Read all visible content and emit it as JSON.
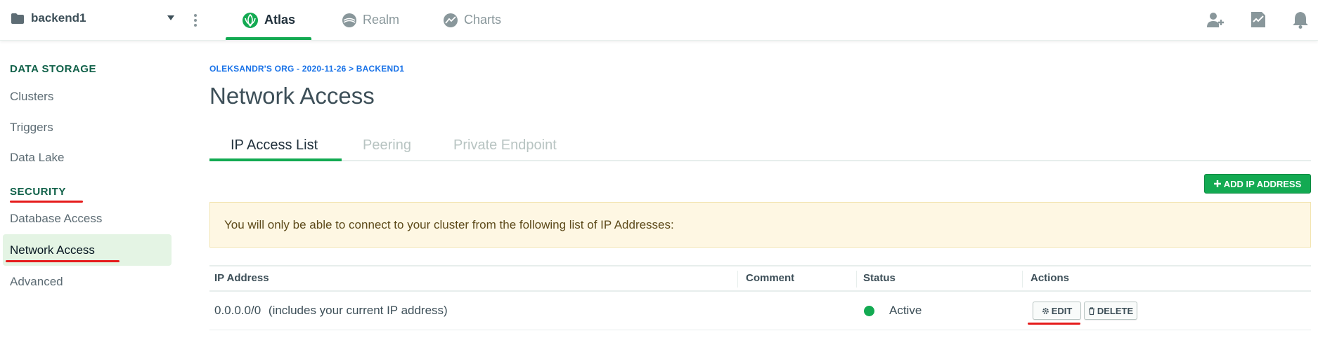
{
  "project": {
    "name": "backend1"
  },
  "nav": {
    "tabs": [
      {
        "label": "Atlas"
      },
      {
        "label": "Realm"
      },
      {
        "label": "Charts"
      }
    ]
  },
  "sidebar": {
    "sections": [
      {
        "heading": "DATA STORAGE",
        "items": [
          {
            "label": "Clusters"
          },
          {
            "label": "Triggers"
          },
          {
            "label": "Data Lake"
          }
        ]
      },
      {
        "heading": "SECURITY",
        "items": [
          {
            "label": "Database Access"
          },
          {
            "label": "Network Access",
            "active": true
          },
          {
            "label": "Advanced"
          }
        ]
      }
    ]
  },
  "breadcrumb": "OLEKSANDR'S ORG - 2020-11-26 > BACKEND1",
  "page_title": "Network Access",
  "tabs": [
    {
      "label": "IP Access List",
      "active": true
    },
    {
      "label": "Peering"
    },
    {
      "label": "Private Endpoint"
    }
  ],
  "add_button": "ADD IP ADDRESS",
  "notice": "You will only be able to connect to your cluster from the following list of IP Addresses:",
  "table": {
    "headers": [
      "IP Address",
      "Comment",
      "Status",
      "Actions"
    ],
    "rows": [
      {
        "ip": "0.0.0.0/0",
        "ip_note": "(includes your current IP address)",
        "comment": "",
        "status": "Active"
      }
    ],
    "edit_label": "EDIT",
    "delete_label": "DELETE"
  },
  "colors": {
    "accent": "#13aa52",
    "annotation": "#e51b1b",
    "link": "#1a73e8"
  }
}
